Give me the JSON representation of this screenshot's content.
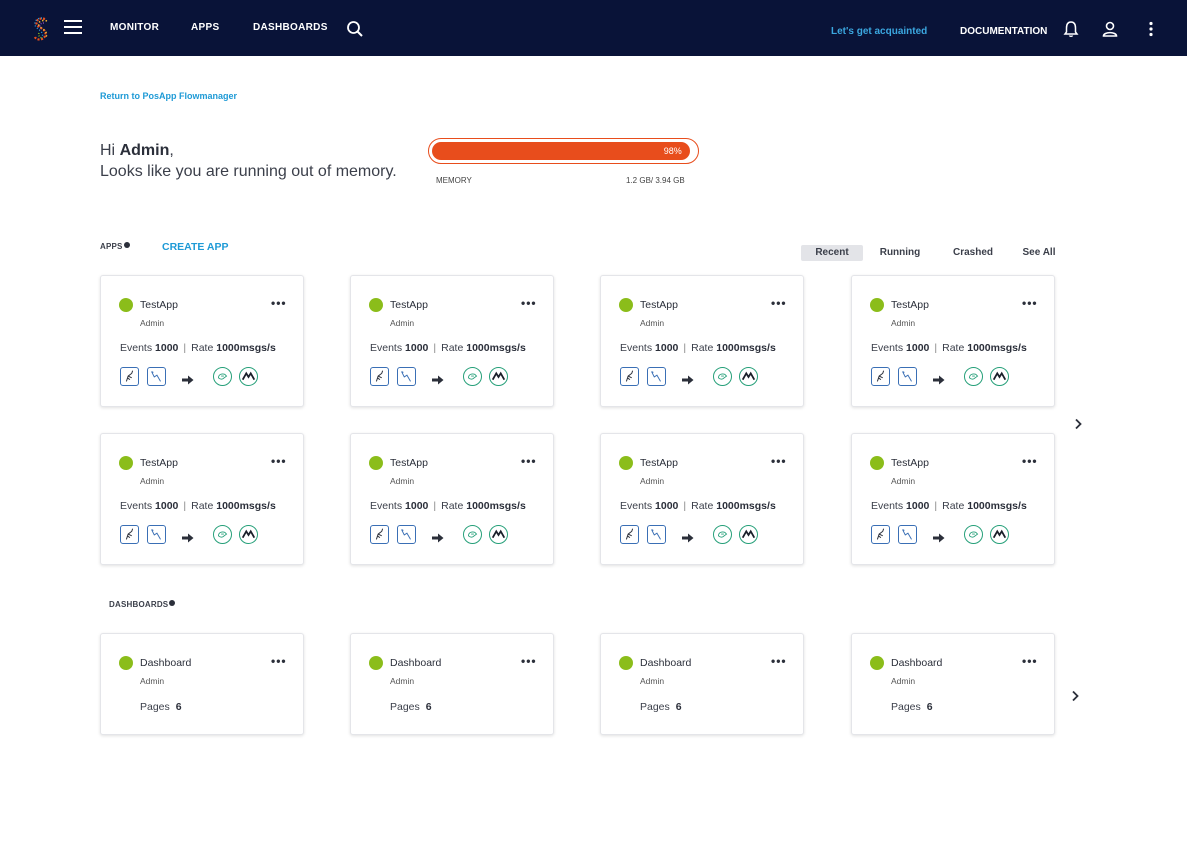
{
  "topbar": {
    "menu_icon": "hamburger-icon",
    "nav": [
      "MONITOR",
      "APPS",
      "DASHBOARDS"
    ],
    "search_icon": "search-icon",
    "acquaint_link": "Let's get acquainted",
    "documentation": "DOCUMENTATION",
    "icons": [
      "bell-icon",
      "user-icon",
      "kebab-menu-icon"
    ],
    "background": "#091338"
  },
  "return_link": "Return to PosApp Flowmanager",
  "greeting": {
    "hi": "Hi ",
    "name": "Admin",
    "comma": ",",
    "message": "Looks like you are running out of memory."
  },
  "memory": {
    "percent_label": "98%",
    "percent": 98,
    "label": "MEMORY",
    "usage": "1.2 GB/ 3.94 GB",
    "color": "#e84d1c"
  },
  "apps": {
    "title": "APPS",
    "create": "CREATE APP",
    "filters": [
      "Recent",
      "Running",
      "Crashed",
      "See All"
    ],
    "active_filter": "Recent",
    "cards": [
      {
        "name": "TestApp",
        "owner": "Admin",
        "events_label": "Events",
        "events": "1000",
        "sep": "|",
        "rate_label": "Rate",
        "rate": "1000msgs/s",
        "status_color": "#8bbd1a"
      },
      {
        "name": "TestApp",
        "owner": "Admin",
        "events_label": "Events",
        "events": "1000",
        "sep": "|",
        "rate_label": "Rate",
        "rate": "1000msgs/s",
        "status_color": "#8bbd1a"
      },
      {
        "name": "TestApp",
        "owner": "Admin",
        "events_label": "Events",
        "events": "1000",
        "sep": "|",
        "rate_label": "Rate",
        "rate": "1000msgs/s",
        "status_color": "#8bbd1a"
      },
      {
        "name": "TestApp",
        "owner": "Admin",
        "events_label": "Events",
        "events": "1000",
        "sep": "|",
        "rate_label": "Rate",
        "rate": "1000msgs/s",
        "status_color": "#8bbd1a"
      },
      {
        "name": "TestApp",
        "owner": "Admin",
        "events_label": "Events",
        "events": "1000",
        "sep": "|",
        "rate_label": "Rate",
        "rate": "1000msgs/s",
        "status_color": "#8bbd1a"
      },
      {
        "name": "TestApp",
        "owner": "Admin",
        "events_label": "Events",
        "events": "1000",
        "sep": "|",
        "rate_label": "Rate",
        "rate": "1000msgs/s",
        "status_color": "#8bbd1a"
      },
      {
        "name": "TestApp",
        "owner": "Admin",
        "events_label": "Events",
        "events": "1000",
        "sep": "|",
        "rate_label": "Rate",
        "rate": "1000msgs/s",
        "status_color": "#8bbd1a"
      },
      {
        "name": "TestApp",
        "owner": "Admin",
        "events_label": "Events",
        "events": "1000",
        "sep": "|",
        "rate_label": "Rate",
        "rate": "1000msgs/s",
        "status_color": "#8bbd1a"
      }
    ],
    "card_icons": [
      "source-adapter-icon",
      "source-flow-icon",
      "arrow-right-icon",
      "target-adapter-icon",
      "target-mountain-icon"
    ],
    "more_icon": "more-dots-icon",
    "next_icon": "chevron-right-icon"
  },
  "dashboards": {
    "title": "DASHBOARDS",
    "cards": [
      {
        "name": "Dashboard",
        "owner": "Admin",
        "pages_label": "Pages",
        "pages": "6",
        "status_color": "#8bbd1a"
      },
      {
        "name": "Dashboard",
        "owner": "Admin",
        "pages_label": "Pages",
        "pages": "6",
        "status_color": "#8bbd1a"
      },
      {
        "name": "Dashboard",
        "owner": "Admin",
        "pages_label": "Pages",
        "pages": "6",
        "status_color": "#8bbd1a"
      },
      {
        "name": "Dashboard",
        "owner": "Admin",
        "pages_label": "Pages",
        "pages": "6",
        "status_color": "#8bbd1a"
      }
    ],
    "next_icon": "chevron-right-icon"
  }
}
